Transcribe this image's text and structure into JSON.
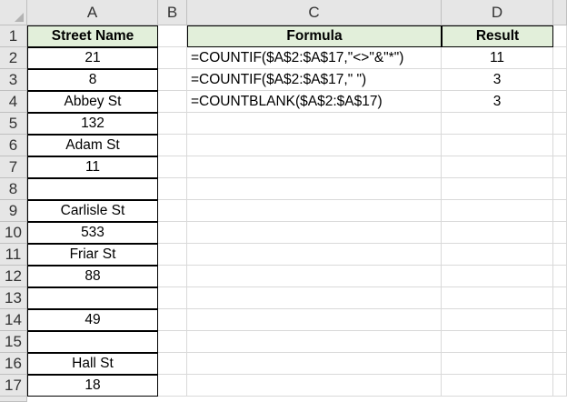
{
  "columns": [
    "A",
    "B",
    "C",
    "D"
  ],
  "rows": [
    "1",
    "2",
    "3",
    "4",
    "5",
    "6",
    "7",
    "8",
    "9",
    "10",
    "11",
    "12",
    "13",
    "14",
    "15",
    "16",
    "17"
  ],
  "headers": {
    "street_name": "Street Name",
    "formula": "Formula",
    "result": "Result"
  },
  "street_names": [
    "21",
    "8",
    "Abbey St",
    "132",
    "Adam St",
    "11",
    "",
    "Carlisle St",
    "533",
    "Friar St",
    "88",
    "",
    "49",
    "",
    "Hall St",
    "18"
  ],
  "formulas": [
    {
      "formula": "=COUNTIF($A$2:$A$17,\"<>\"&\"*\")",
      "result": "11"
    },
    {
      "formula": "=COUNTIF($A$2:$A$17,\" \")",
      "result": "3"
    },
    {
      "formula": "=COUNTBLANK($A$2:$A$17)",
      "result": "3"
    }
  ],
  "colors": {
    "header_fill": "#e2efda",
    "gridline": "#d9d9d9",
    "heading_bg": "#e6e6e6"
  }
}
